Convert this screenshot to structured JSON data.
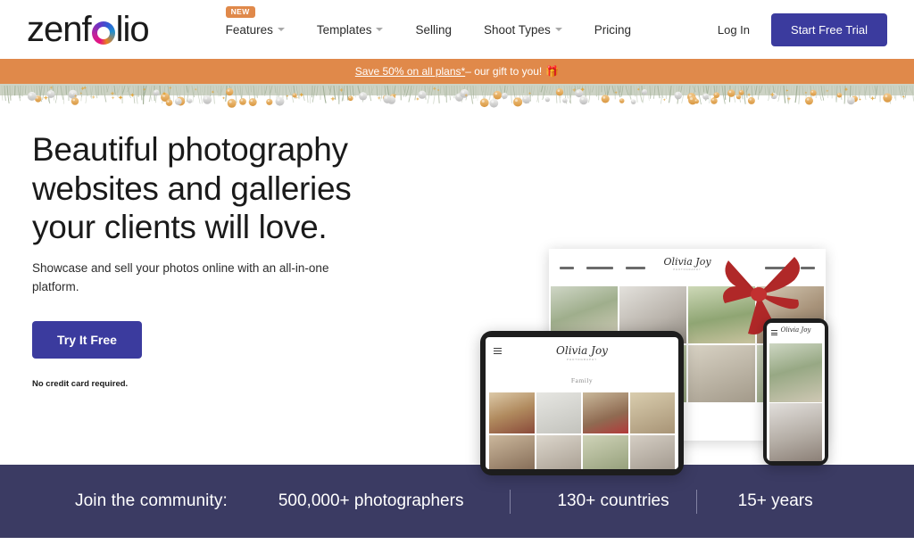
{
  "header": {
    "logo": {
      "part1": "zenf",
      "ring_icon": "gradient-ring-o",
      "part2": "lio"
    },
    "nav": [
      {
        "label": "Features",
        "has_caret": true,
        "badge": "NEW"
      },
      {
        "label": "Templates",
        "has_caret": true,
        "badge": ""
      },
      {
        "label": "Selling",
        "has_caret": false,
        "badge": ""
      },
      {
        "label": "Shoot Types",
        "has_caret": true,
        "badge": ""
      },
      {
        "label": "Pricing",
        "has_caret": false,
        "badge": ""
      }
    ],
    "login_label": "Log In",
    "trial_button": "Start Free Trial"
  },
  "promo": {
    "link_text": "Save 50% on all plans*",
    "rest_text": " – our gift to you!",
    "gift_icon": "🎁",
    "background": "#e0894a"
  },
  "decor": {
    "garland": "holiday-pine-garland-with-gold-and-silver-ornaments"
  },
  "hero": {
    "title_line1": "Beautiful photography",
    "title_line2": "websites and galleries",
    "title_line3": "your clients will love.",
    "subtitle": "Showcase and sell your photos online with an all-in-one platform.",
    "cta_label": "Try It Free",
    "disclaimer": "No credit card required."
  },
  "mockups": {
    "desktop": {
      "brand": "Olivia Joy",
      "brand_sub": "PHOTOGRAPHY",
      "nav_items": [
        "HOME",
        "MY PORTFOLIO",
        "MY CLIENTS",
        "MY SERVICES",
        "MORE"
      ],
      "bow_icon": "red-gift-bow"
    },
    "tablet": {
      "brand": "Olivia Joy",
      "brand_sub": "PHOTOGRAPHY",
      "menu_icon": "hamburger-icon",
      "gallery_title": "Family"
    },
    "phone": {
      "brand": "Olivia Joy",
      "menu_icon": "hamburger-icon"
    }
  },
  "stats": {
    "label": "Join the community:",
    "items": [
      {
        "value": "500,000+ photographers"
      },
      {
        "value": "130+ countries"
      },
      {
        "value": "15+ years"
      }
    ],
    "background": "#3b3b63"
  },
  "colors": {
    "brand_indigo": "#3b3b9e",
    "promo_orange": "#e0894a",
    "stats_navy": "#3b3b63",
    "bow_red": "#b02828"
  }
}
